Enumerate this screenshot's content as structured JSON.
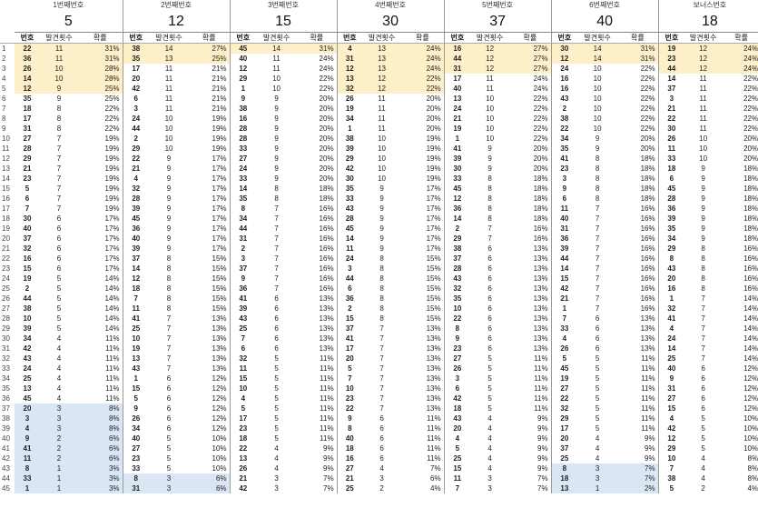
{
  "groups": [
    {
      "title": "1번째번호",
      "value": "5"
    },
    {
      "title": "2번째번호",
      "value": "12"
    },
    {
      "title": "3번째번호",
      "value": "15"
    },
    {
      "title": "4번째번호",
      "value": "30"
    },
    {
      "title": "5번째번호",
      "value": "37"
    },
    {
      "title": "6번째번호",
      "value": "40"
    },
    {
      "title": "보너스번호",
      "value": "18"
    }
  ],
  "headers": {
    "num": "번호",
    "count": "발견횟수",
    "pct": "확률"
  },
  "colors": {
    "yellow": "#fdf0c8",
    "blue": "#dbe6f5"
  },
  "rows": [
    [
      [
        22,
        11,
        "31%"
      ],
      [
        38,
        14,
        "27%"
      ],
      [
        45,
        14,
        "31%"
      ],
      [
        4,
        13,
        "24%"
      ],
      [
        16,
        12,
        "27%"
      ],
      [
        30,
        14,
        "31%"
      ],
      [
        19,
        12,
        "24%"
      ]
    ],
    [
      [
        36,
        11,
        "31%"
      ],
      [
        35,
        13,
        "25%"
      ],
      [
        40,
        11,
        "24%"
      ],
      [
        31,
        13,
        "24%"
      ],
      [
        44,
        12,
        "27%"
      ],
      [
        12,
        14,
        "31%"
      ],
      [
        23,
        12,
        "24%"
      ]
    ],
    [
      [
        26,
        10,
        "28%"
      ],
      [
        17,
        11,
        "21%"
      ],
      [
        12,
        11,
        "24%"
      ],
      [
        12,
        13,
        "24%"
      ],
      [
        31,
        12,
        "27%"
      ],
      [
        24,
        10,
        "22%"
      ],
      [
        44,
        12,
        "24%"
      ]
    ],
    [
      [
        14,
        10,
        "28%"
      ],
      [
        20,
        11,
        "21%"
      ],
      [
        29,
        10,
        "22%"
      ],
      [
        13,
        12,
        "22%"
      ],
      [
        17,
        11,
        "24%"
      ],
      [
        16,
        10,
        "22%"
      ],
      [
        14,
        11,
        "22%"
      ]
    ],
    [
      [
        12,
        9,
        "25%"
      ],
      [
        42,
        11,
        "21%"
      ],
      [
        1,
        10,
        "22%"
      ],
      [
        32,
        12,
        "22%"
      ],
      [
        40,
        11,
        "24%"
      ],
      [
        16,
        10,
        "22%"
      ],
      [
        37,
        11,
        "22%"
      ]
    ],
    [
      [
        35,
        9,
        "25%"
      ],
      [
        6,
        11,
        "21%"
      ],
      [
        9,
        9,
        "20%"
      ],
      [
        26,
        11,
        "20%"
      ],
      [
        13,
        10,
        "22%"
      ],
      [
        43,
        10,
        "22%"
      ],
      [
        3,
        11,
        "22%"
      ]
    ],
    [
      [
        18,
        8,
        "22%"
      ],
      [
        3,
        11,
        "21%"
      ],
      [
        38,
        9,
        "20%"
      ],
      [
        19,
        11,
        "20%"
      ],
      [
        24,
        10,
        "22%"
      ],
      [
        2,
        10,
        "22%"
      ],
      [
        21,
        11,
        "22%"
      ]
    ],
    [
      [
        17,
        8,
        "22%"
      ],
      [
        24,
        10,
        "19%"
      ],
      [
        16,
        9,
        "20%"
      ],
      [
        34,
        11,
        "20%"
      ],
      [
        21,
        10,
        "22%"
      ],
      [
        38,
        10,
        "22%"
      ],
      [
        22,
        11,
        "22%"
      ]
    ],
    [
      [
        31,
        8,
        "22%"
      ],
      [
        44,
        10,
        "19%"
      ],
      [
        28,
        9,
        "20%"
      ],
      [
        1,
        11,
        "20%"
      ],
      [
        19,
        10,
        "22%"
      ],
      [
        22,
        10,
        "22%"
      ],
      [
        30,
        11,
        "22%"
      ]
    ],
    [
      [
        27,
        7,
        "19%"
      ],
      [
        2,
        10,
        "19%"
      ],
      [
        28,
        9,
        "20%"
      ],
      [
        38,
        10,
        "19%"
      ],
      [
        1,
        10,
        "22%"
      ],
      [
        34,
        9,
        "20%"
      ],
      [
        26,
        10,
        "20%"
      ]
    ],
    [
      [
        28,
        7,
        "19%"
      ],
      [
        29,
        10,
        "19%"
      ],
      [
        33,
        9,
        "20%"
      ],
      [
        39,
        10,
        "19%"
      ],
      [
        41,
        9,
        "20%"
      ],
      [
        35,
        9,
        "20%"
      ],
      [
        11,
        10,
        "20%"
      ]
    ],
    [
      [
        29,
        7,
        "19%"
      ],
      [
        22,
        9,
        "17%"
      ],
      [
        27,
        9,
        "20%"
      ],
      [
        29,
        10,
        "19%"
      ],
      [
        39,
        9,
        "20%"
      ],
      [
        41,
        8,
        "18%"
      ],
      [
        33,
        10,
        "20%"
      ]
    ],
    [
      [
        21,
        7,
        "19%"
      ],
      [
        21,
        9,
        "17%"
      ],
      [
        24,
        9,
        "20%"
      ],
      [
        42,
        10,
        "19%"
      ],
      [
        30,
        9,
        "20%"
      ],
      [
        23,
        8,
        "18%"
      ],
      [
        18,
        9,
        "18%"
      ]
    ],
    [
      [
        23,
        7,
        "19%"
      ],
      [
        4,
        9,
        "17%"
      ],
      [
        33,
        9,
        "20%"
      ],
      [
        30,
        10,
        "19%"
      ],
      [
        33,
        8,
        "18%"
      ],
      [
        3,
        8,
        "18%"
      ],
      [
        6,
        9,
        "18%"
      ]
    ],
    [
      [
        5,
        7,
        "19%"
      ],
      [
        32,
        9,
        "17%"
      ],
      [
        14,
        8,
        "18%"
      ],
      [
        35,
        9,
        "17%"
      ],
      [
        45,
        8,
        "18%"
      ],
      [
        9,
        8,
        "18%"
      ],
      [
        45,
        9,
        "18%"
      ]
    ],
    [
      [
        6,
        7,
        "19%"
      ],
      [
        28,
        9,
        "17%"
      ],
      [
        35,
        8,
        "18%"
      ],
      [
        33,
        9,
        "17%"
      ],
      [
        12,
        8,
        "18%"
      ],
      [
        6,
        8,
        "18%"
      ],
      [
        28,
        9,
        "18%"
      ]
    ],
    [
      [
        7,
        7,
        "19%"
      ],
      [
        39,
        9,
        "17%"
      ],
      [
        8,
        7,
        "16%"
      ],
      [
        43,
        9,
        "17%"
      ],
      [
        36,
        8,
        "18%"
      ],
      [
        11,
        7,
        "16%"
      ],
      [
        36,
        9,
        "18%"
      ]
    ],
    [
      [
        30,
        6,
        "17%"
      ],
      [
        45,
        9,
        "17%"
      ],
      [
        34,
        7,
        "16%"
      ],
      [
        28,
        9,
        "17%"
      ],
      [
        14,
        8,
        "18%"
      ],
      [
        40,
        7,
        "16%"
      ],
      [
        39,
        9,
        "18%"
      ]
    ],
    [
      [
        40,
        6,
        "17%"
      ],
      [
        36,
        9,
        "17%"
      ],
      [
        44,
        7,
        "16%"
      ],
      [
        45,
        9,
        "17%"
      ],
      [
        2,
        7,
        "16%"
      ],
      [
        31,
        7,
        "16%"
      ],
      [
        35,
        9,
        "18%"
      ]
    ],
    [
      [
        37,
        6,
        "17%"
      ],
      [
        40,
        9,
        "17%"
      ],
      [
        31,
        7,
        "16%"
      ],
      [
        14,
        9,
        "17%"
      ],
      [
        29,
        7,
        "16%"
      ],
      [
        36,
        7,
        "16%"
      ],
      [
        34,
        9,
        "18%"
      ]
    ],
    [
      [
        32,
        6,
        "17%"
      ],
      [
        39,
        9,
        "17%"
      ],
      [
        2,
        7,
        "16%"
      ],
      [
        11,
        9,
        "17%"
      ],
      [
        38,
        6,
        "13%"
      ],
      [
        39,
        7,
        "16%"
      ],
      [
        29,
        8,
        "16%"
      ]
    ],
    [
      [
        16,
        6,
        "17%"
      ],
      [
        37,
        8,
        "15%"
      ],
      [
        3,
        7,
        "16%"
      ],
      [
        24,
        8,
        "15%"
      ],
      [
        37,
        6,
        "13%"
      ],
      [
        44,
        7,
        "16%"
      ],
      [
        8,
        8,
        "16%"
      ]
    ],
    [
      [
        15,
        6,
        "17%"
      ],
      [
        14,
        8,
        "15%"
      ],
      [
        37,
        7,
        "16%"
      ],
      [
        3,
        8,
        "15%"
      ],
      [
        28,
        6,
        "13%"
      ],
      [
        14,
        7,
        "16%"
      ],
      [
        43,
        8,
        "16%"
      ]
    ],
    [
      [
        19,
        5,
        "14%"
      ],
      [
        12,
        8,
        "15%"
      ],
      [
        9,
        7,
        "16%"
      ],
      [
        44,
        8,
        "15%"
      ],
      [
        43,
        6,
        "13%"
      ],
      [
        15,
        7,
        "16%"
      ],
      [
        20,
        8,
        "16%"
      ]
    ],
    [
      [
        2,
        5,
        "14%"
      ],
      [
        18,
        8,
        "15%"
      ],
      [
        36,
        7,
        "16%"
      ],
      [
        6,
        8,
        "15%"
      ],
      [
        32,
        6,
        "13%"
      ],
      [
        42,
        7,
        "16%"
      ],
      [
        16,
        8,
        "16%"
      ]
    ],
    [
      [
        44,
        5,
        "14%"
      ],
      [
        7,
        8,
        "15%"
      ],
      [
        41,
        6,
        "13%"
      ],
      [
        36,
        8,
        "15%"
      ],
      [
        35,
        6,
        "13%"
      ],
      [
        21,
        7,
        "16%"
      ],
      [
        1,
        7,
        "14%"
      ]
    ],
    [
      [
        38,
        5,
        "14%"
      ],
      [
        11,
        8,
        "15%"
      ],
      [
        39,
        6,
        "13%"
      ],
      [
        2,
        8,
        "15%"
      ],
      [
        10,
        6,
        "13%"
      ],
      [
        1,
        7,
        "16%"
      ],
      [
        32,
        7,
        "14%"
      ]
    ],
    [
      [
        10,
        5,
        "14%"
      ],
      [
        41,
        7,
        "13%"
      ],
      [
        43,
        6,
        "13%"
      ],
      [
        15,
        8,
        "15%"
      ],
      [
        22,
        6,
        "13%"
      ],
      [
        7,
        6,
        "13%"
      ],
      [
        41,
        7,
        "14%"
      ]
    ],
    [
      [
        39,
        5,
        "14%"
      ],
      [
        25,
        7,
        "13%"
      ],
      [
        25,
        6,
        "13%"
      ],
      [
        37,
        7,
        "13%"
      ],
      [
        8,
        6,
        "13%"
      ],
      [
        33,
        6,
        "13%"
      ],
      [
        4,
        7,
        "14%"
      ]
    ],
    [
      [
        34,
        4,
        "11%"
      ],
      [
        10,
        7,
        "13%"
      ],
      [
        7,
        6,
        "13%"
      ],
      [
        41,
        7,
        "13%"
      ],
      [
        9,
        6,
        "13%"
      ],
      [
        4,
        6,
        "13%"
      ],
      [
        24,
        7,
        "14%"
      ]
    ],
    [
      [
        42,
        4,
        "11%"
      ],
      [
        19,
        7,
        "13%"
      ],
      [
        6,
        6,
        "13%"
      ],
      [
        17,
        7,
        "13%"
      ],
      [
        23,
        6,
        "13%"
      ],
      [
        26,
        6,
        "13%"
      ],
      [
        14,
        7,
        "14%"
      ]
    ],
    [
      [
        43,
        4,
        "11%"
      ],
      [
        13,
        7,
        "13%"
      ],
      [
        32,
        5,
        "11%"
      ],
      [
        20,
        7,
        "13%"
      ],
      [
        27,
        5,
        "11%"
      ],
      [
        5,
        5,
        "11%"
      ],
      [
        25,
        7,
        "14%"
      ]
    ],
    [
      [
        24,
        4,
        "11%"
      ],
      [
        43,
        7,
        "13%"
      ],
      [
        11,
        5,
        "11%"
      ],
      [
        5,
        7,
        "13%"
      ],
      [
        26,
        5,
        "11%"
      ],
      [
        45,
        5,
        "11%"
      ],
      [
        40,
        6,
        "12%"
      ]
    ],
    [
      [
        25,
        4,
        "11%"
      ],
      [
        1,
        6,
        "12%"
      ],
      [
        15,
        5,
        "11%"
      ],
      [
        7,
        7,
        "13%"
      ],
      [
        3,
        5,
        "11%"
      ],
      [
        19,
        5,
        "11%"
      ],
      [
        9,
        6,
        "12%"
      ]
    ],
    [
      [
        13,
        4,
        "11%"
      ],
      [
        15,
        6,
        "12%"
      ],
      [
        10,
        5,
        "11%"
      ],
      [
        10,
        7,
        "13%"
      ],
      [
        6,
        5,
        "11%"
      ],
      [
        27,
        5,
        "11%"
      ],
      [
        31,
        6,
        "12%"
      ]
    ],
    [
      [
        45,
        4,
        "11%"
      ],
      [
        5,
        6,
        "12%"
      ],
      [
        4,
        5,
        "11%"
      ],
      [
        23,
        7,
        "13%"
      ],
      [
        42,
        5,
        "11%"
      ],
      [
        22,
        5,
        "11%"
      ],
      [
        27,
        6,
        "12%"
      ]
    ],
    [
      [
        20,
        3,
        "8%"
      ],
      [
        9,
        6,
        "12%"
      ],
      [
        5,
        5,
        "11%"
      ],
      [
        22,
        7,
        "13%"
      ],
      [
        18,
        5,
        "11%"
      ],
      [
        32,
        5,
        "11%"
      ],
      [
        15,
        6,
        "12%"
      ]
    ],
    [
      [
        3,
        3,
        "8%"
      ],
      [
        26,
        6,
        "12%"
      ],
      [
        17,
        5,
        "11%"
      ],
      [
        9,
        6,
        "11%"
      ],
      [
        43,
        4,
        "9%"
      ],
      [
        29,
        5,
        "11%"
      ],
      [
        4,
        5,
        "10%"
      ]
    ],
    [
      [
        4,
        3,
        "8%"
      ],
      [
        34,
        6,
        "12%"
      ],
      [
        23,
        5,
        "11%"
      ],
      [
        8,
        6,
        "11%"
      ],
      [
        20,
        4,
        "9%"
      ],
      [
        17,
        5,
        "11%"
      ],
      [
        42,
        5,
        "10%"
      ]
    ],
    [
      [
        9,
        2,
        "6%"
      ],
      [
        40,
        5,
        "10%"
      ],
      [
        18,
        5,
        "11%"
      ],
      [
        40,
        6,
        "11%"
      ],
      [
        4,
        4,
        "9%"
      ],
      [
        20,
        4,
        "9%"
      ],
      [
        12,
        5,
        "10%"
      ]
    ],
    [
      [
        41,
        2,
        "6%"
      ],
      [
        27,
        5,
        "10%"
      ],
      [
        22,
        4,
        "9%"
      ],
      [
        18,
        6,
        "11%"
      ],
      [
        5,
        4,
        "9%"
      ],
      [
        37,
        4,
        "9%"
      ],
      [
        29,
        5,
        "10%"
      ]
    ],
    [
      [
        11,
        2,
        "6%"
      ],
      [
        23,
        5,
        "10%"
      ],
      [
        13,
        4,
        "9%"
      ],
      [
        16,
        6,
        "11%"
      ],
      [
        25,
        4,
        "9%"
      ],
      [
        25,
        4,
        "9%"
      ],
      [
        10,
        4,
        "8%"
      ]
    ],
    [
      [
        8,
        1,
        "3%"
      ],
      [
        33,
        5,
        "10%"
      ],
      [
        26,
        4,
        "9%"
      ],
      [
        27,
        4,
        "7%"
      ],
      [
        15,
        4,
        "9%"
      ],
      [
        8,
        3,
        "7%"
      ],
      [
        7,
        4,
        "8%"
      ]
    ],
    [
      [
        33,
        1,
        "3%"
      ],
      [
        8,
        3,
        "6%"
      ],
      [
        21,
        3,
        "7%"
      ],
      [
        21,
        3,
        "6%"
      ],
      [
        11,
        3,
        "7%"
      ],
      [
        18,
        3,
        "7%"
      ],
      [
        38,
        4,
        "8%"
      ]
    ],
    [
      [
        1,
        1,
        "3%"
      ],
      [
        31,
        3,
        "6%"
      ],
      [
        42,
        3,
        "7%"
      ],
      [
        25,
        2,
        "4%"
      ],
      [
        7,
        3,
        "7%"
      ],
      [
        13,
        1,
        "2%"
      ],
      [
        5,
        2,
        "4%"
      ]
    ]
  ]
}
